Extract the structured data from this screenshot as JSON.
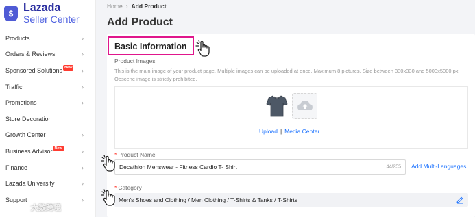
{
  "app": {
    "brand": "Lazada",
    "product": "Seller Center",
    "logo_glyph": "$",
    "accent_color": "#4f5bd5",
    "brand_color": "#2b2fa0"
  },
  "sidebar": {
    "items": [
      {
        "label": "Products",
        "new": false,
        "has_chevron": true
      },
      {
        "label": "Orders & Reviews",
        "new": false,
        "has_chevron": true
      },
      {
        "label": "Sponsored Solutions",
        "new": true,
        "has_chevron": true
      },
      {
        "label": "Traffic",
        "new": false,
        "has_chevron": true
      },
      {
        "label": "Promotions",
        "new": false,
        "has_chevron": true
      },
      {
        "label": "Store Decoration",
        "new": false,
        "has_chevron": false
      },
      {
        "label": "Growth Center",
        "new": false,
        "has_chevron": true
      },
      {
        "label": "Business Advisor",
        "new": true,
        "has_chevron": true
      },
      {
        "label": "Finance",
        "new": false,
        "has_chevron": true
      },
      {
        "label": "Lazada University",
        "new": false,
        "has_chevron": true
      },
      {
        "label": "Support",
        "new": false,
        "has_chevron": true
      }
    ],
    "new_badge_label": "New",
    "chevron_glyph": "›"
  },
  "breadcrumb": {
    "home": "Home",
    "separator": "›",
    "current": "Add Product"
  },
  "page": {
    "title": "Add Product"
  },
  "form": {
    "section_title": "Basic Information",
    "highlight_color": "#e0168c",
    "images": {
      "label": "Product Images",
      "hint": "This is the main image of your product page. Multiple images can be uploaded at once. Maximum 8 pictures. Size between 330x330 and 5000x5000 px. Obscene image is strictly prohibited.",
      "upload_link": "Upload",
      "separator": "|",
      "media_center_link": "Media Center"
    },
    "product_name": {
      "required_mark": "*",
      "label": "Product Name",
      "value": "Decathlon Menswear - Fitness Cardio T- Shirt",
      "counter": "44/255",
      "multi_language_link": "Add Multi-Languages"
    },
    "category": {
      "required_mark": "*",
      "label": "Category",
      "value": "Men's Shoes and Clothing / Men Clothing / T-Shirts & Tanks / T-Shirts"
    }
  },
  "watermark": {
    "text": "大数跨境"
  }
}
